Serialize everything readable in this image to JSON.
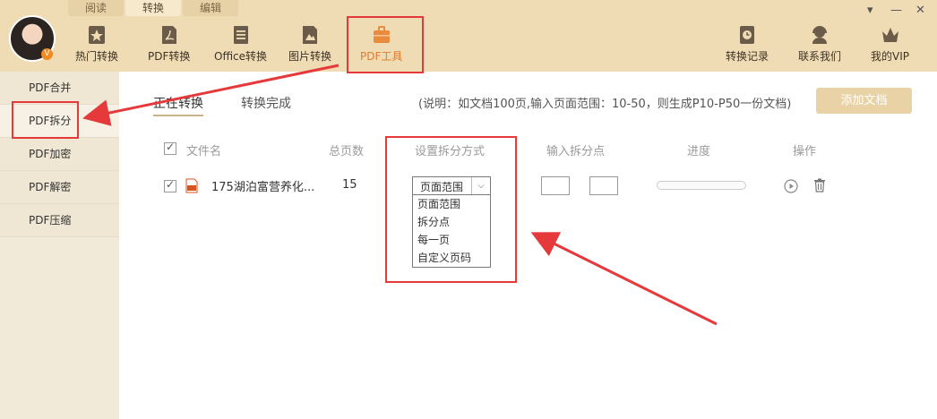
{
  "tabs": [
    "阅读",
    "转换",
    "编辑"
  ],
  "active_tab": "转换",
  "avatar_badge": "V",
  "toolbar_left": [
    {
      "label": "热门转换",
      "icon": "star-icon"
    },
    {
      "label": "PDF转换",
      "icon": "pdf-icon"
    },
    {
      "label": "Office转换",
      "icon": "document-icon"
    },
    {
      "label": "图片转换",
      "icon": "image-icon"
    },
    {
      "label": "PDF工具",
      "icon": "toolbox-icon"
    }
  ],
  "toolbar_right": [
    {
      "label": "转换记录",
      "icon": "clock-icon"
    },
    {
      "label": "联系我们",
      "icon": "headset-icon"
    },
    {
      "label": "我的VIP",
      "icon": "crown-icon"
    }
  ],
  "window_controls": [
    "▾",
    "—",
    "✕"
  ],
  "sidebar": [
    "PDF合并",
    "PDF拆分",
    "PDF加密",
    "PDF解密",
    "PDF压缩"
  ],
  "subtabs": [
    "正在转换",
    "转换完成"
  ],
  "note": "(说明：如文档100页,输入页面范围：10-50，则生成P10-P50一份文档)",
  "add_button": "添加文档",
  "columns": {
    "filename": "文件名",
    "pages": "总页数",
    "split_mode": "设置拆分方式",
    "split_points": "输入拆分点",
    "progress": "进度",
    "actions": "操作"
  },
  "file_row": {
    "name": "175湖泊富营养化...",
    "pages": "15",
    "split_mode": "页面范围",
    "progress": 0
  },
  "split_options": [
    "页面范围",
    "拆分点",
    "每一页",
    "自定义页码"
  ],
  "colors": {
    "accent": "#e07b2c",
    "highlight": "#e5393b",
    "header": "#efdcb5"
  }
}
